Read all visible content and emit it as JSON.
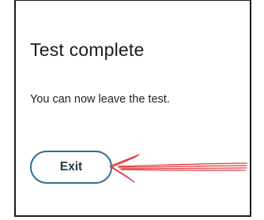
{
  "dialog": {
    "title": "Test complete",
    "message": "You can now leave the test.",
    "exit_label": "Exit"
  },
  "colors": {
    "button_border": "#2f6e8e",
    "button_text": "#1f3a4c",
    "annotation_arrow": "#e0383e"
  },
  "annotation": {
    "icon": "red-hand-drawn-arrow-icon",
    "points_to": "exit-button"
  }
}
